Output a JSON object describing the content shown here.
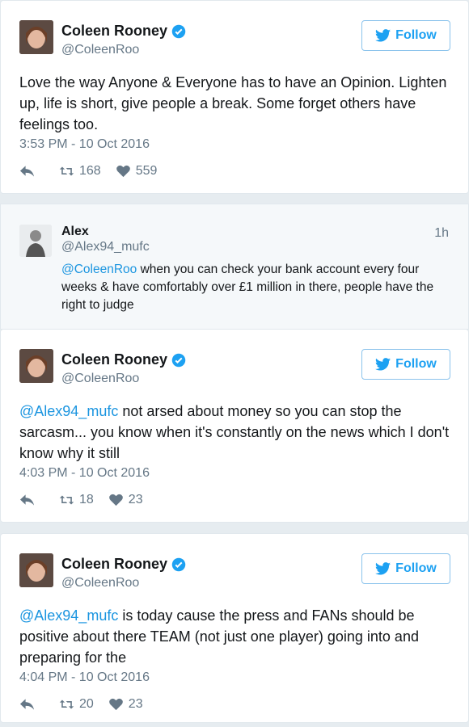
{
  "tweets": [
    {
      "name": "Coleen Rooney",
      "handle": "@ColeenRoo",
      "follow_label": "Follow",
      "text": "Love the way Anyone & Everyone has to have an Opinion. Lighten up, life is short, give people a break. Some forget others have feelings too.",
      "mention": "",
      "time": "3:53 PM - 10 Oct 2016",
      "retweets": "168",
      "likes": "559"
    },
    {
      "name": "Coleen Rooney",
      "handle": "@ColeenRoo",
      "follow_label": "Follow",
      "mention": "@Alex94_mufc",
      "text": " not arsed about money so you can stop the sarcasm... you know when it's constantly on the news which I don't know why it still",
      "time": "4:03 PM - 10 Oct 2016",
      "retweets": "18",
      "likes": "23"
    },
    {
      "name": "Coleen Rooney",
      "handle": "@ColeenRoo",
      "follow_label": "Follow",
      "mention": "@Alex94_mufc",
      "text": " is today cause the press and FANs should be positive about there TEAM (not just one player) going into and preparing for the",
      "time": "4:04 PM - 10 Oct 2016",
      "retweets": "20",
      "likes": "23"
    }
  ],
  "reply": {
    "name": "Alex",
    "handle": "@Alex94_mufc",
    "age": "1h",
    "mention": "@ColeenRoo",
    "text": " when you can check your bank account every four weeks & have comfortably over £1 million in there, people have the right to judge"
  },
  "colors": {
    "link": "#1b95e0",
    "follow": "#1da1f2",
    "verified": "#1da1f2"
  }
}
